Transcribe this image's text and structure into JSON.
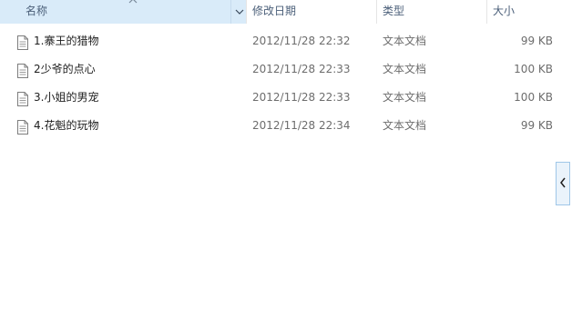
{
  "columns": {
    "name": "名称",
    "date": "修改日期",
    "type": "类型",
    "size": "大小"
  },
  "files": [
    {
      "name": "1.寨王的猎物",
      "date": "2012/11/28 22:32",
      "type": "文本文档",
      "size": "99 KB"
    },
    {
      "name": "2少爷的点心",
      "date": "2012/11/28 22:33",
      "type": "文本文档",
      "size": "100 KB"
    },
    {
      "name": "3.小姐的男宠",
      "date": "2012/11/28 22:33",
      "type": "文本文档",
      "size": "100 KB"
    },
    {
      "name": "4.花魁的玩物",
      "date": "2012/11/28 22:34",
      "type": "文本文档",
      "size": "99 KB"
    }
  ],
  "icons": {
    "sort": "sort-up-icon",
    "column_dropdown": "chevron-down-icon",
    "file": "text-file-icon",
    "side_panel": "chevron-left-icon"
  },
  "colors": {
    "selected_header_bg": "#d9ebf9",
    "header_text": "#4c607a",
    "secondary_text": "#6d6d6d"
  }
}
